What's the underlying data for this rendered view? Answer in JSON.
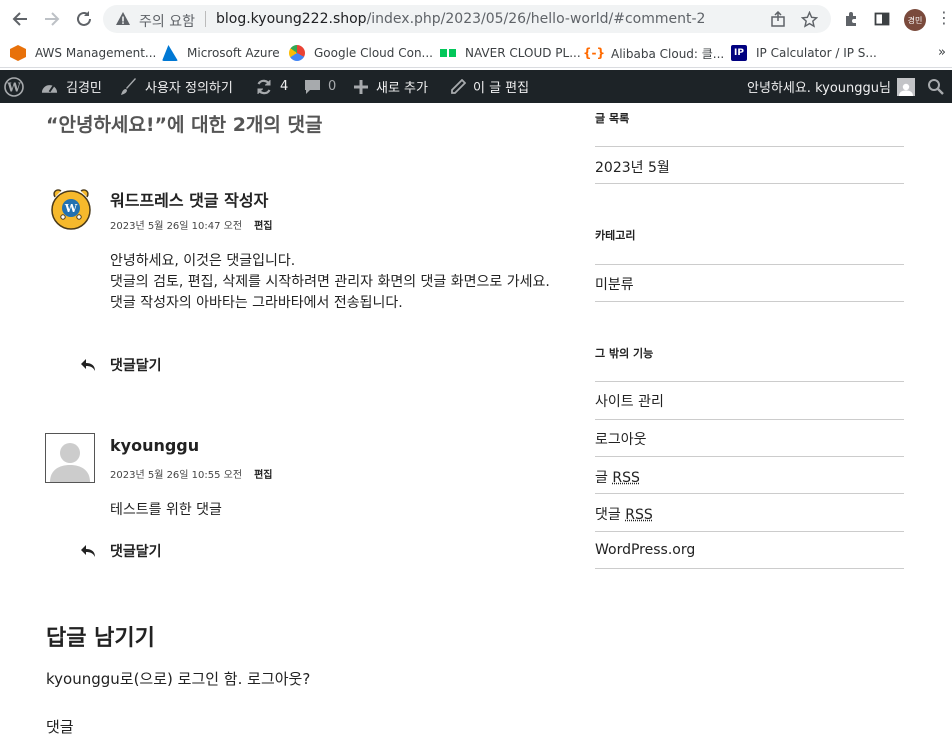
{
  "browser": {
    "security_label": "주의 요함",
    "url_host": "blog.kyoung222.shop",
    "url_path": "/index.php/2023/05/26/hello-world/#comment-2",
    "profile_initials": "경민",
    "bookmarks": [
      {
        "label": "AWS Management...",
        "color": "#ff9900"
      },
      {
        "label": "Microsoft Azure",
        "color": "#0078d4"
      },
      {
        "label": "Google Cloud Con...",
        "color": "#fbbc04"
      },
      {
        "label": "NAVER CLOUD PL...",
        "color": "#03c75a"
      },
      {
        "label": "Alibaba Cloud: 클...",
        "color": "#ff6a00"
      },
      {
        "label": "IP Calculator / IP S...",
        "color": "#000080"
      }
    ],
    "bookmarks_more": "»"
  },
  "adminbar": {
    "site_name": "김경민",
    "customize": "사용자 정의하기",
    "updates_count": "4",
    "comments_count": "0",
    "new": "새로 추가",
    "edit_post": "이 글 편집",
    "greeting": "안녕하세요. kyounggu님"
  },
  "comments": {
    "title": "“안녕하세요!”에 대한 2개의 댓글",
    "items": [
      {
        "author": "워드프레스 댓글 작성자",
        "date": "2023년 5월 26일 10:47 오전",
        "edit": "편집",
        "lines": [
          "안녕하세요, 이것은 댓글입니다.",
          "댓글의 검토, 편집, 삭제를 시작하려면 관리자 화면의 댓글 화면으로 가세요.",
          "댓글 작성자의 아바타는 그라바타에서 전송됩니다."
        ],
        "reply": "댓글달기"
      },
      {
        "author": "kyounggu",
        "date": "2023년 5월 26일 10:55 오전",
        "edit": "편집",
        "lines": [
          "테스트를 위한 댓글"
        ],
        "reply": "댓글달기"
      }
    ]
  },
  "reply_form": {
    "title": "답글 남기기",
    "logged_in": "kyounggu로(으로) 로그인 함. 로그아웃?",
    "comment_label": "댓글"
  },
  "sidebar": {
    "archives_heading": "글 목록",
    "archives": [
      "2023년 5월"
    ],
    "categories_heading": "카테고리",
    "categories": [
      "미분류"
    ],
    "meta_heading": "그 밖의 기능",
    "meta": {
      "site_admin": "사이트 관리",
      "logout": "로그아웃",
      "entries_prefix": "글",
      "comments_prefix": "댓글",
      "rss": "RSS",
      "wordpress_org": "WordPress.org"
    }
  }
}
